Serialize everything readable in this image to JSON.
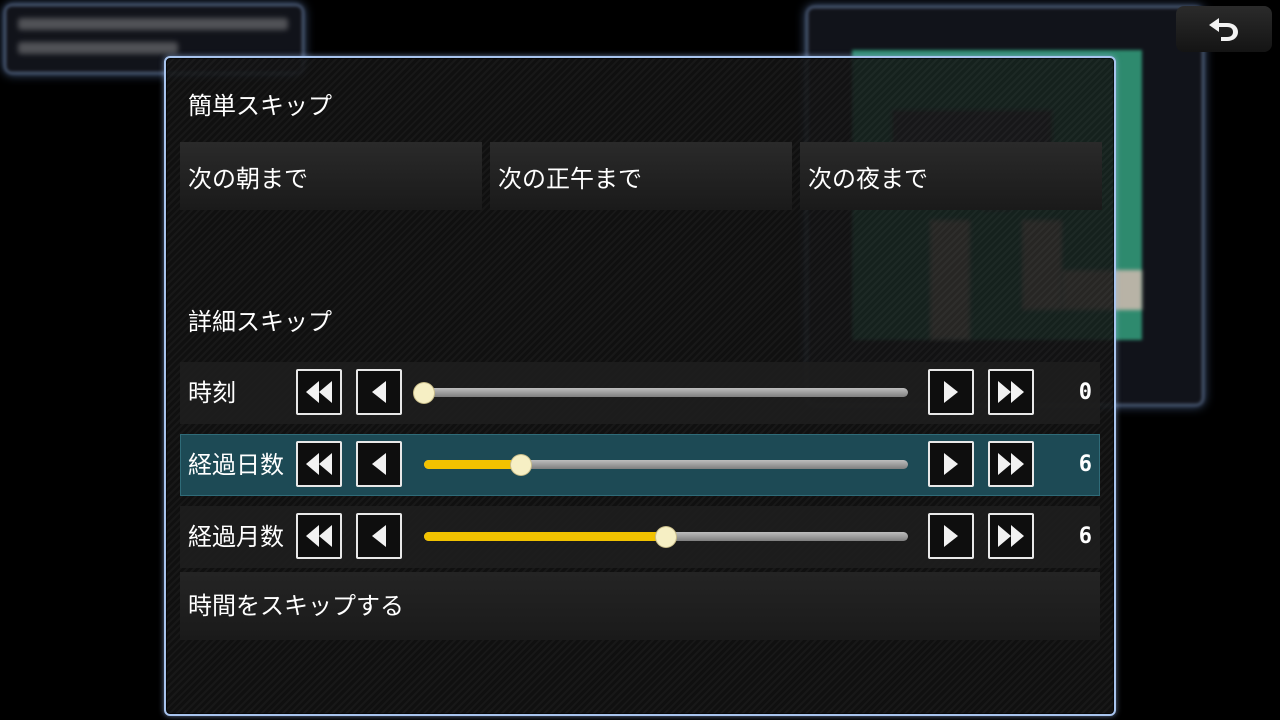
{
  "screen": {
    "quick_skip": {
      "title": "簡単スキップ",
      "buttons": [
        "次の朝まで",
        "次の正午まで",
        "次の夜まで"
      ]
    },
    "detail_skip": {
      "title": "詳細スキップ",
      "rows": [
        {
          "label": "時刻",
          "value": "0",
          "fraction": 0.0,
          "selected": false
        },
        {
          "label": "経過日数",
          "value": "6",
          "fraction": 0.2,
          "selected": true
        },
        {
          "label": "経過月数",
          "value": "6",
          "fraction": 0.5,
          "selected": false
        }
      ]
    },
    "skip_button": "時間をスキップする"
  },
  "icons": {
    "back": "return-arrow-icon",
    "fast_back": "double-left-triangle-icon",
    "step_back": "left-triangle-icon",
    "step_forward": "right-triangle-icon",
    "fast_forward": "double-right-triangle-icon"
  },
  "colors": {
    "frame_border": "#a8c4ee",
    "selected_row": "#1d4a55",
    "slider_fill": "#f2c200",
    "knob": "#f6efc4"
  }
}
